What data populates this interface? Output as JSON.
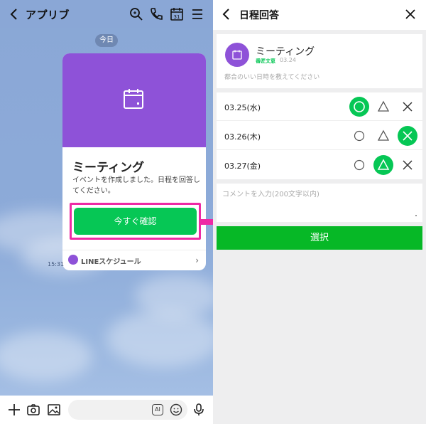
{
  "left_screen": {
    "header": {
      "title": "アプリブ"
    },
    "date_pill": "今日",
    "card": {
      "title": "ミーティング",
      "description": "イベントを作成しました。日程を回答してください。",
      "cta_label": "今すぐ確認",
      "footer_label": "LINEスケジュール"
    },
    "message_time": "15:31",
    "bottom_bar": {
      "ai_label": "AI"
    }
  },
  "right_screen": {
    "header": {
      "title": "日程回答"
    },
    "event": {
      "name": "ミーティング",
      "author": "番匠文恵",
      "date": "03.24",
      "hint": "都合のいい日時を教えてください"
    },
    "options": [
      {
        "date": "03.25(水)",
        "selected": "circle"
      },
      {
        "date": "03.26(木)",
        "selected": "cross"
      },
      {
        "date": "03.27(金)",
        "selected": "triangle"
      }
    ],
    "comment_placeholder": "コメントを入力(200文字以内)",
    "select_label": "選択"
  },
  "colors": {
    "line_green": "#06c755",
    "purple": "#8e52d8",
    "highlight_pink": "#ee2aa5",
    "chat_background": "#8aa7d6"
  }
}
